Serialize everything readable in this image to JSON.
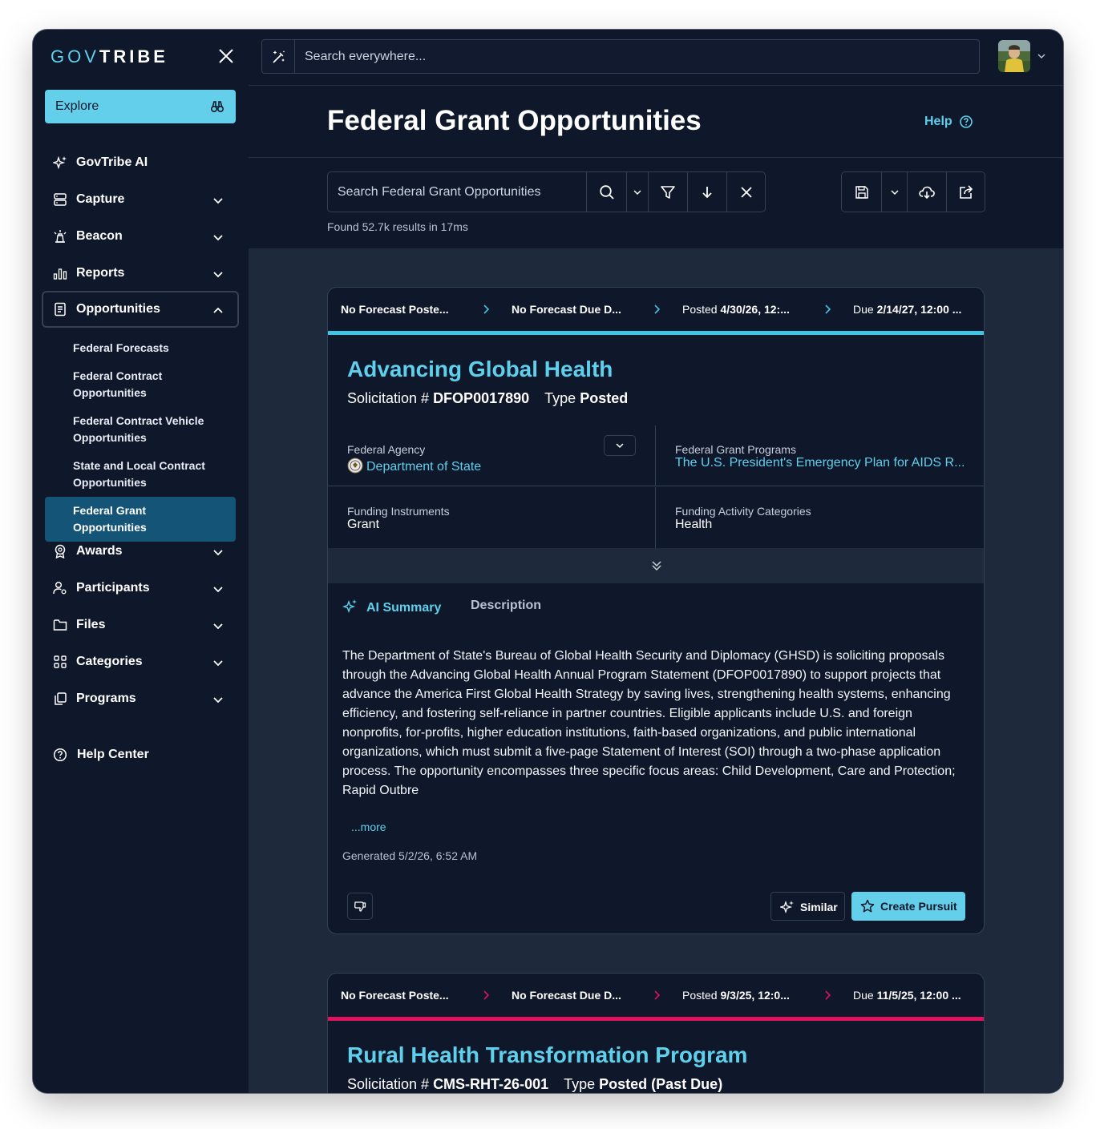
{
  "app": {
    "logo_part1": "GOV",
    "logo_part2": "TRIBE"
  },
  "sidebar": {
    "explore_label": "Explore",
    "items": [
      {
        "label": "GovTribe AI"
      },
      {
        "label": "Capture"
      },
      {
        "label": "Beacon"
      },
      {
        "label": "Reports"
      },
      {
        "label": "Opportunities"
      },
      {
        "label": "Awards"
      },
      {
        "label": "Participants"
      },
      {
        "label": "Files"
      },
      {
        "label": "Categories"
      },
      {
        "label": "Programs"
      }
    ],
    "sub_items": [
      {
        "label": "Federal Forecasts"
      },
      {
        "label": "Federal Contract Opportunities"
      },
      {
        "label": "Federal Contract Vehicle Opportunities"
      },
      {
        "label": "State and Local Contract Opportunities"
      },
      {
        "label": "Federal Grant Opportunities"
      }
    ],
    "help_center": "Help Center"
  },
  "topbar": {
    "search_placeholder": "Search everywhere..."
  },
  "header": {
    "title": "Federal Grant Opportunities",
    "help_label": "Help"
  },
  "toolbar": {
    "search_placeholder": "Search Federal Grant Opportunities",
    "results_text": "Found 52.7k results in 17ms"
  },
  "colors": {
    "accent": "#5fd0ec",
    "posted": "#3fc4e6",
    "past_due": "#e0115f"
  },
  "cards": [
    {
      "steps": [
        {
          "prefix": "",
          "bold": "No Forecast Poste..."
        },
        {
          "prefix": "",
          "bold": "No Forecast Due D..."
        },
        {
          "prefix": "Posted ",
          "bold": "4/30/26, 12:..."
        },
        {
          "prefix": "Due ",
          "bold": "2/14/27, 12:00 ..."
        }
      ],
      "title": "Advancing Global Health",
      "solicitation_label": "Solicitation # ",
      "solicitation_number": "DFOP0017890",
      "type_label": "Type ",
      "type_value": "Posted",
      "agency_label": "Federal Agency",
      "agency_value": "Department of State",
      "programs_label": "Federal Grant Programs",
      "programs_value": "The U.S. President's Emergency Plan for AIDS R...",
      "instruments_label": "Funding Instruments",
      "instruments_value": "Grant",
      "categories_label": "Funding Activity Categories",
      "categories_value": "Health",
      "tab_ai": "AI Summary",
      "tab_desc": "Description",
      "summary": "The Department of State's Bureau of Global Health Security and Diplomacy (GHSD) is soliciting proposals through the Advancing Global Health Annual Program Statement (DFOP0017890) to support projects that advance the America First Global Health Strategy by saving lives, strengthening health systems, enhancing efficiency, and fostering self-reliance in partner countries. Eligible applicants include U.S. and foreign nonprofits, for-profits, higher education institutions, faith-based organizations, and public international organizations, which must submit a five-page Statement of Interest (SOI) through a two-phase application process. The opportunity encompasses three specific focus areas: Child Development, Care and Protection; Rapid Outbre",
      "more_label": "...more",
      "generated": "Generated 5/2/26, 6:52 AM",
      "similar_label": "Similar",
      "pursuit_label": "Create Pursuit"
    },
    {
      "steps": [
        {
          "prefix": "",
          "bold": "No Forecast Poste..."
        },
        {
          "prefix": "",
          "bold": "No Forecast Due D..."
        },
        {
          "prefix": "Posted ",
          "bold": "9/3/25, 12:0..."
        },
        {
          "prefix": "Due ",
          "bold": "11/5/25, 12:00 ..."
        }
      ],
      "title": "Rural Health Transformation Program",
      "solicitation_label": "Solicitation # ",
      "solicitation_number": "CMS-RHT-26-001",
      "type_label": "Type ",
      "type_value": "Posted (Past Due)"
    }
  ]
}
